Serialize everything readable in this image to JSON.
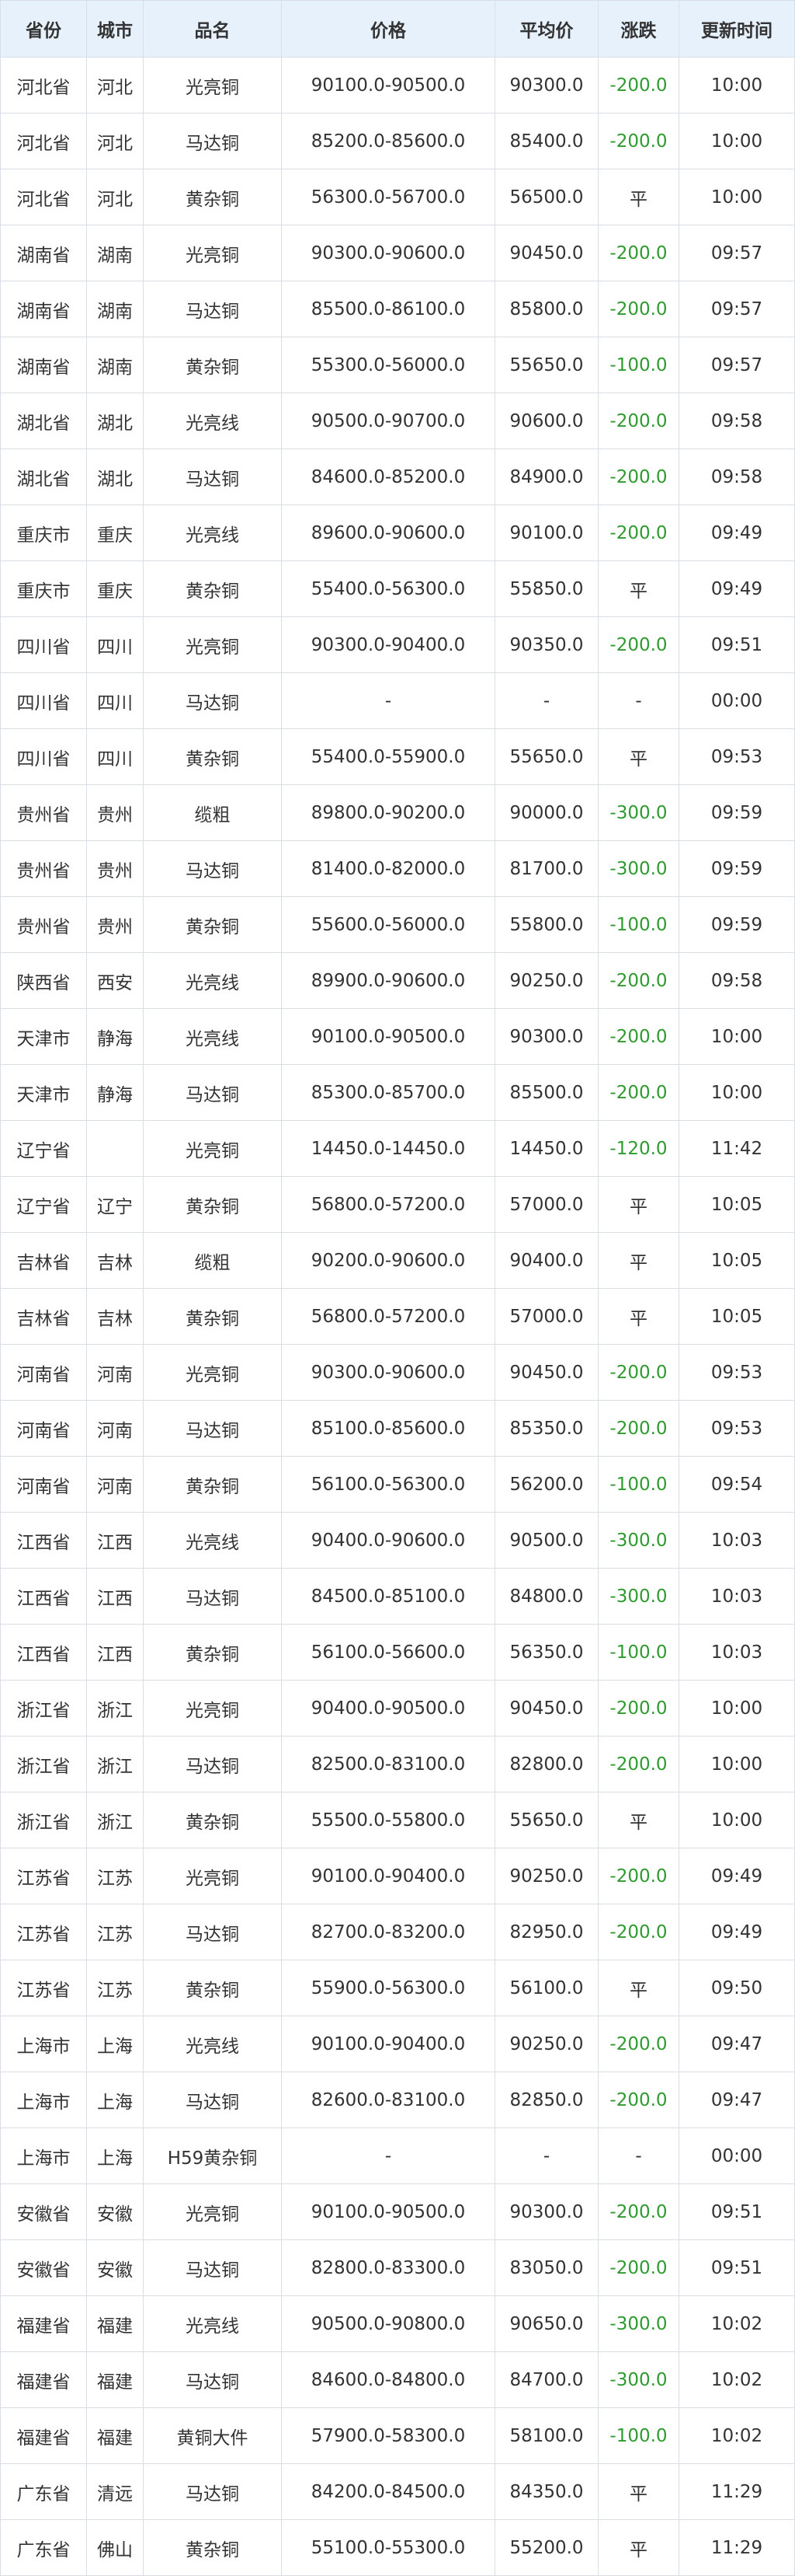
{
  "table": {
    "headers": [
      "省份",
      "城市",
      "品名",
      "价格",
      "平均价",
      "涨跌",
      "更新时间"
    ],
    "rows": [
      [
        "河北省",
        "河北",
        "光亮铜",
        "90100.0-90500.0",
        "90300.0",
        "-200.0",
        "10:00"
      ],
      [
        "河北省",
        "河北",
        "马达铜",
        "85200.0-85600.0",
        "85400.0",
        "-200.0",
        "10:00"
      ],
      [
        "河北省",
        "河北",
        "黄杂铜",
        "56300.0-56700.0",
        "56500.0",
        "平",
        "10:00"
      ],
      [
        "湖南省",
        "湖南",
        "光亮铜",
        "90300.0-90600.0",
        "90450.0",
        "-200.0",
        "09:57"
      ],
      [
        "湖南省",
        "湖南",
        "马达铜",
        "85500.0-86100.0",
        "85800.0",
        "-200.0",
        "09:57"
      ],
      [
        "湖南省",
        "湖南",
        "黄杂铜",
        "55300.0-56000.0",
        "55650.0",
        "-100.0",
        "09:57"
      ],
      [
        "湖北省",
        "湖北",
        "光亮线",
        "90500.0-90700.0",
        "90600.0",
        "-200.0",
        "09:58"
      ],
      [
        "湖北省",
        "湖北",
        "马达铜",
        "84600.0-85200.0",
        "84900.0",
        "-200.0",
        "09:58"
      ],
      [
        "重庆市",
        "重庆",
        "光亮线",
        "89600.0-90600.0",
        "90100.0",
        "-200.0",
        "09:49"
      ],
      [
        "重庆市",
        "重庆",
        "黄杂铜",
        "55400.0-56300.0",
        "55850.0",
        "平",
        "09:49"
      ],
      [
        "四川省",
        "四川",
        "光亮铜",
        "90300.0-90400.0",
        "90350.0",
        "-200.0",
        "09:51"
      ],
      [
        "四川省",
        "四川",
        "马达铜",
        "-",
        "-",
        "-",
        "00:00"
      ],
      [
        "四川省",
        "四川",
        "黄杂铜",
        "55400.0-55900.0",
        "55650.0",
        "平",
        "09:53"
      ],
      [
        "贵州省",
        "贵州",
        "缆粗",
        "89800.0-90200.0",
        "90000.0",
        "-300.0",
        "09:59"
      ],
      [
        "贵州省",
        "贵州",
        "马达铜",
        "81400.0-82000.0",
        "81700.0",
        "-300.0",
        "09:59"
      ],
      [
        "贵州省",
        "贵州",
        "黄杂铜",
        "55600.0-56000.0",
        "55800.0",
        "-100.0",
        "09:59"
      ],
      [
        "陕西省",
        "西安",
        "光亮线",
        "89900.0-90600.0",
        "90250.0",
        "-200.0",
        "09:58"
      ],
      [
        "天津市",
        "静海",
        "光亮线",
        "90100.0-90500.0",
        "90300.0",
        "-200.0",
        "10:00"
      ],
      [
        "天津市",
        "静海",
        "马达铜",
        "85300.0-85700.0",
        "85500.0",
        "-200.0",
        "10:00"
      ],
      [
        "辽宁省",
        "",
        "光亮铜",
        "14450.0-14450.0",
        "14450.0",
        "-120.0",
        "11:42"
      ],
      [
        "辽宁省",
        "辽宁",
        "黄杂铜",
        "56800.0-57200.0",
        "57000.0",
        "平",
        "10:05"
      ],
      [
        "吉林省",
        "吉林",
        "缆粗",
        "90200.0-90600.0",
        "90400.0",
        "平",
        "10:05"
      ],
      [
        "吉林省",
        "吉林",
        "黄杂铜",
        "56800.0-57200.0",
        "57000.0",
        "平",
        "10:05"
      ],
      [
        "河南省",
        "河南",
        "光亮铜",
        "90300.0-90600.0",
        "90450.0",
        "-200.0",
        "09:53"
      ],
      [
        "河南省",
        "河南",
        "马达铜",
        "85100.0-85600.0",
        "85350.0",
        "-200.0",
        "09:53"
      ],
      [
        "河南省",
        "河南",
        "黄杂铜",
        "56100.0-56300.0",
        "56200.0",
        "-100.0",
        "09:54"
      ],
      [
        "江西省",
        "江西",
        "光亮线",
        "90400.0-90600.0",
        "90500.0",
        "-300.0",
        "10:03"
      ],
      [
        "江西省",
        "江西",
        "马达铜",
        "84500.0-85100.0",
        "84800.0",
        "-300.0",
        "10:03"
      ],
      [
        "江西省",
        "江西",
        "黄杂铜",
        "56100.0-56600.0",
        "56350.0",
        "-100.0",
        "10:03"
      ],
      [
        "浙江省",
        "浙江",
        "光亮铜",
        "90400.0-90500.0",
        "90450.0",
        "-200.0",
        "10:00"
      ],
      [
        "浙江省",
        "浙江",
        "马达铜",
        "82500.0-83100.0",
        "82800.0",
        "-200.0",
        "10:00"
      ],
      [
        "浙江省",
        "浙江",
        "黄杂铜",
        "55500.0-55800.0",
        "55650.0",
        "平",
        "10:00"
      ],
      [
        "江苏省",
        "江苏",
        "光亮铜",
        "90100.0-90400.0",
        "90250.0",
        "-200.0",
        "09:49"
      ],
      [
        "江苏省",
        "江苏",
        "马达铜",
        "82700.0-83200.0",
        "82950.0",
        "-200.0",
        "09:49"
      ],
      [
        "江苏省",
        "江苏",
        "黄杂铜",
        "55900.0-56300.0",
        "56100.0",
        "平",
        "09:50"
      ],
      [
        "上海市",
        "上海",
        "光亮线",
        "90100.0-90400.0",
        "90250.0",
        "-200.0",
        "09:47"
      ],
      [
        "上海市",
        "上海",
        "马达铜",
        "82600.0-83100.0",
        "82850.0",
        "-200.0",
        "09:47"
      ],
      [
        "上海市",
        "上海",
        "H59黄杂铜",
        "-",
        "-",
        "-",
        "00:00"
      ],
      [
        "安徽省",
        "安徽",
        "光亮铜",
        "90100.0-90500.0",
        "90300.0",
        "-200.0",
        "09:51"
      ],
      [
        "安徽省",
        "安徽",
        "马达铜",
        "82800.0-83300.0",
        "83050.0",
        "-200.0",
        "09:51"
      ],
      [
        "福建省",
        "福建",
        "光亮线",
        "90500.0-90800.0",
        "90650.0",
        "-300.0",
        "10:02"
      ],
      [
        "福建省",
        "福建",
        "马达铜",
        "84600.0-84800.0",
        "84700.0",
        "-300.0",
        "10:02"
      ],
      [
        "福建省",
        "福建",
        "黄铜大件",
        "57900.0-58300.0",
        "58100.0",
        "-100.0",
        "10:02"
      ],
      [
        "广东省",
        "清远",
        "马达铜",
        "84200.0-84500.0",
        "84350.0",
        "平",
        "11:29"
      ],
      [
        "广东省",
        "佛山",
        "黄杂铜",
        "55100.0-55300.0",
        "55200.0",
        "平",
        "11:29"
      ]
    ]
  },
  "colors": {
    "header_bg": "#e6f1fb",
    "border": "#d7dee8",
    "change_down": "#2e9b2e",
    "change_up": "#d83a3a",
    "text": "#333333"
  }
}
